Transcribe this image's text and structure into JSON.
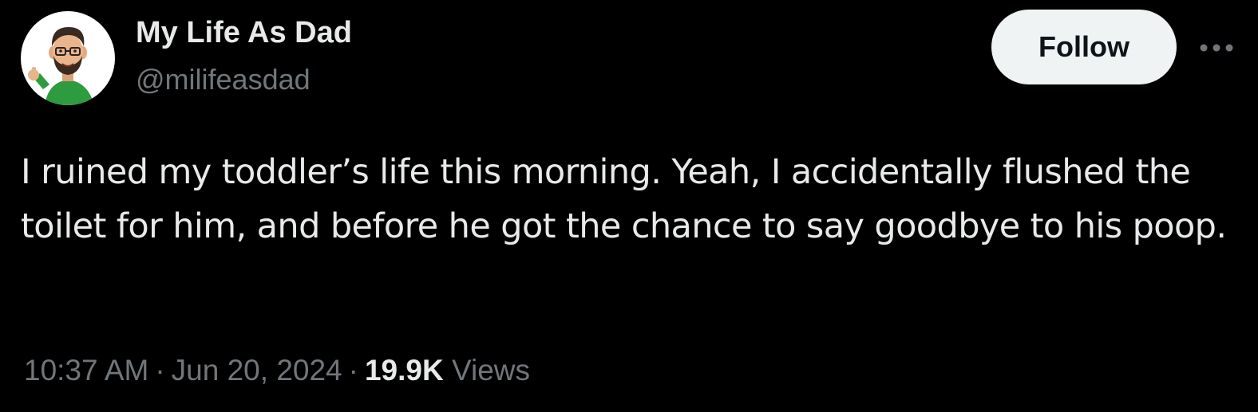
{
  "author": {
    "display_name": "My Life As Dad",
    "handle": "@milifeasdad",
    "avatar_icon": "bitmoji-dad-thumbs-up-avatar"
  },
  "actions": {
    "follow_label": "Follow",
    "more_icon": "more-horizontal-icon"
  },
  "tweet": {
    "text": "I ruined my toddler’s life this morning. Yeah, I accidentally flushed the toilet for him, and before he got the chance to say goodbye to his poop."
  },
  "meta": {
    "time": "10:37 AM",
    "separator": "·",
    "date": "Jun 20, 2024",
    "views_count": "19.9K",
    "views_label": "Views"
  },
  "colors": {
    "background": "#000000",
    "primary_text": "#e7e9ea",
    "secondary_text": "#71767b",
    "follow_button_bg": "#eff3f4",
    "follow_button_text": "#0f1419"
  }
}
